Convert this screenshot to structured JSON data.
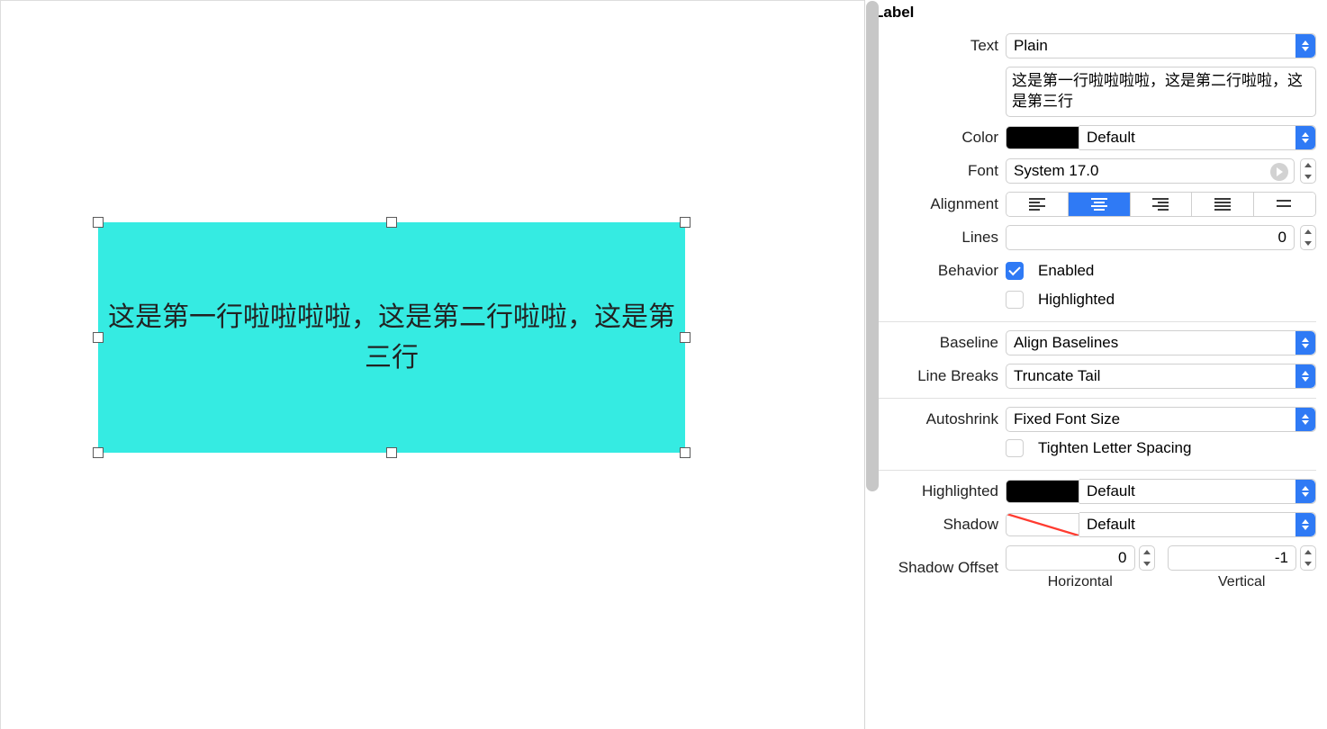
{
  "canvas": {
    "label_text": "这是第一行啦啦啦啦，这是第二行啦啦，这是第三行"
  },
  "inspector": {
    "section_title": "Label",
    "text": {
      "label": "Text",
      "value": "Plain"
    },
    "text_content": "这是第一行啦啦啦啦，这是第二行啦啦，这是第三行",
    "color": {
      "label": "Color",
      "value": "Default"
    },
    "font": {
      "label": "Font",
      "value": "System 17.0"
    },
    "alignment": {
      "label": "Alignment",
      "selected_index": 1
    },
    "lines": {
      "label": "Lines",
      "value": "0"
    },
    "behavior": {
      "label": "Behavior",
      "enabled_label": "Enabled",
      "enabled_checked": true,
      "highlighted_label": "Highlighted",
      "highlighted_checked": false
    },
    "baseline": {
      "label": "Baseline",
      "value": "Align Baselines"
    },
    "line_breaks": {
      "label": "Line Breaks",
      "value": "Truncate Tail"
    },
    "autoshrink": {
      "label": "Autoshrink",
      "value": "Fixed Font Size"
    },
    "tighten": {
      "label": "Tighten Letter Spacing",
      "checked": false
    },
    "highlighted_color": {
      "label": "Highlighted",
      "value": "Default"
    },
    "shadow": {
      "label": "Shadow",
      "value": "Default"
    },
    "shadow_offset": {
      "label": "Shadow Offset",
      "horizontal": {
        "value": "0",
        "sub": "Horizontal"
      },
      "vertical": {
        "value": "-1",
        "sub": "Vertical"
      }
    }
  }
}
